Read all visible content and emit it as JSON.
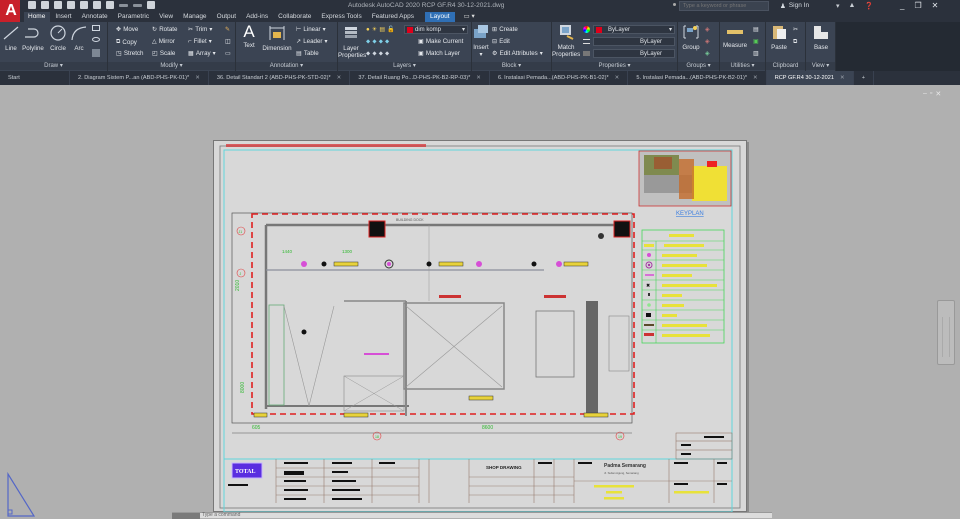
{
  "app": {
    "logo_letter": "A",
    "title": "Autodesk AutoCAD 2020   RCP GF.R4 30-12-2021.dwg",
    "search_placeholder": "Type a keyword or phrase",
    "sign_in": "Sign In"
  },
  "ribbon_tabs": [
    "Home",
    "Insert",
    "Annotate",
    "Parametric",
    "View",
    "Manage",
    "Output",
    "Add-ins",
    "Collaborate",
    "Express Tools",
    "Featured Apps",
    "Layout"
  ],
  "active_tab": "Home",
  "panels": {
    "draw": {
      "label": "Draw",
      "tools": [
        "Line",
        "Polyline",
        "Circle",
        "Arc"
      ]
    },
    "modify": {
      "label": "Modify",
      "tools": [
        "Move",
        "Rotate",
        "Trim",
        "Copy",
        "Mirror",
        "Fillet",
        "Stretch",
        "Scale",
        "Array"
      ]
    },
    "annotation": {
      "label": "Annotation",
      "tools": [
        "Text",
        "Dimension",
        "Linear",
        "Leader",
        "Table"
      ]
    },
    "layers": {
      "label": "Layers",
      "tools": [
        "Layer Properties",
        "Make Current",
        "Match Layer"
      ],
      "current_layer": "dim komp"
    },
    "block": {
      "label": "Block",
      "tools": [
        "Insert",
        "Create",
        "Edit",
        "Edit Attributes"
      ]
    },
    "properties": {
      "label": "Properties",
      "tools": [
        "Match Properties"
      ],
      "color": "ByLayer",
      "linetype": "ByLayer",
      "lineweight": "ByLayer"
    },
    "groups": {
      "label": "Groups",
      "tools": [
        "Group"
      ]
    },
    "utilities": {
      "label": "Utilities",
      "tools": [
        "Measure"
      ]
    },
    "clipboard": {
      "label": "Clipboard",
      "tools": [
        "Paste"
      ]
    },
    "view": {
      "label": "View",
      "tools": [
        "Base"
      ]
    }
  },
  "doc_tabs": [
    {
      "label": "Start",
      "closable": false
    },
    {
      "label": "2. Diagram Sistem P...an (ABD-PHS-PK-01)*",
      "closable": true
    },
    {
      "label": "36. Detail Standart 2 (ABD-PHS-PK-STD-02)*",
      "closable": true
    },
    {
      "label": "37. Detail Ruang Po...D-PHS-PK-B2-RP-03)*",
      "closable": true
    },
    {
      "label": "6. Instalasi Pemada...(ABD-PHS-PK-B1-02)*",
      "closable": true
    },
    {
      "label": "5. Instalasi Pemada...(ABD-PHS-PK-B2-01)*",
      "closable": true
    },
    {
      "label": "RCP GF.R4 30-12-2021",
      "closable": true,
      "active": true
    }
  ],
  "drawing": {
    "keyplan_label": "KEYPLAN",
    "building_label": "BUILDING DOCK",
    "dims": {
      "left_total": "8000",
      "left_upper": "2010",
      "bottom_right": "8600",
      "bottom_left": "605",
      "d1440": "1440",
      "d1300": "1300"
    },
    "grid_bubbles": [
      "J1",
      "J",
      "18",
      "19"
    ],
    "title_block": {
      "logo": "TOTAL",
      "drawing_type": "SHOP DRAWING",
      "project": "Padma Semarang",
      "project_sub": "Jl. Sultan Agung, Semarang"
    }
  },
  "command_line": {
    "placeholder": "Type a command"
  }
}
